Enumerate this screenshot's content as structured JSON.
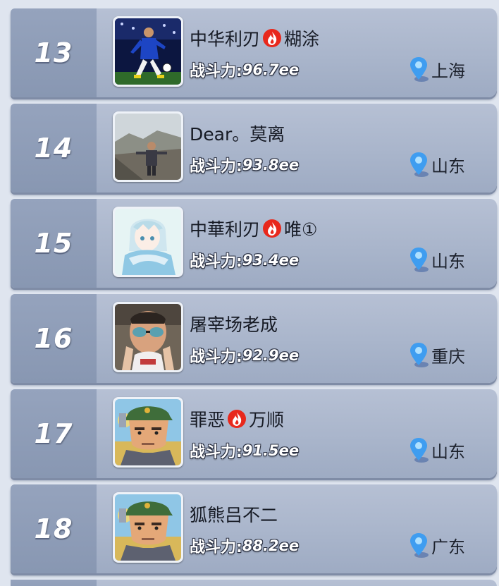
{
  "labels": {
    "power_prefix": "战斗力:"
  },
  "colors": {
    "row_bg": "#aab5cb",
    "rank_bg": "#8f9db8",
    "pin": "#3f9df0",
    "flame": "#e8281c"
  },
  "icons": {
    "location": "location-pin-icon",
    "guild": "flame-icon"
  },
  "rows": [
    {
      "rank": "13",
      "name_a": "中华利刃",
      "has_flame": true,
      "name_b": "糊涂",
      "power": "96.7ee",
      "location": "上海",
      "avatar": "soccer-player-avatar"
    },
    {
      "rank": "14",
      "name_a": "Dear。莫离",
      "has_flame": false,
      "name_b": "",
      "power": "93.8ee",
      "location": "山东",
      "avatar": "travel-photo-avatar"
    },
    {
      "rank": "15",
      "name_a": "中華利刃",
      "has_flame": true,
      "name_b": "唯①",
      "power": "93.4ee",
      "location": "山东",
      "avatar": "anime-character-avatar"
    },
    {
      "rank": "16",
      "name_a": "屠宰场老成",
      "has_flame": false,
      "name_b": "",
      "power": "92.9ee",
      "location": "重庆",
      "avatar": "child-sunglasses-avatar"
    },
    {
      "rank": "17",
      "name_a": "罪恶",
      "has_flame": true,
      "name_b": "万顺",
      "power": "91.5ee",
      "location": "山东",
      "avatar": "soldier-avatar"
    },
    {
      "rank": "18",
      "name_a": "狐熊吕不二",
      "has_flame": false,
      "name_b": "",
      "power": "88.2ee",
      "location": "广东",
      "avatar": "soldier-avatar"
    }
  ]
}
